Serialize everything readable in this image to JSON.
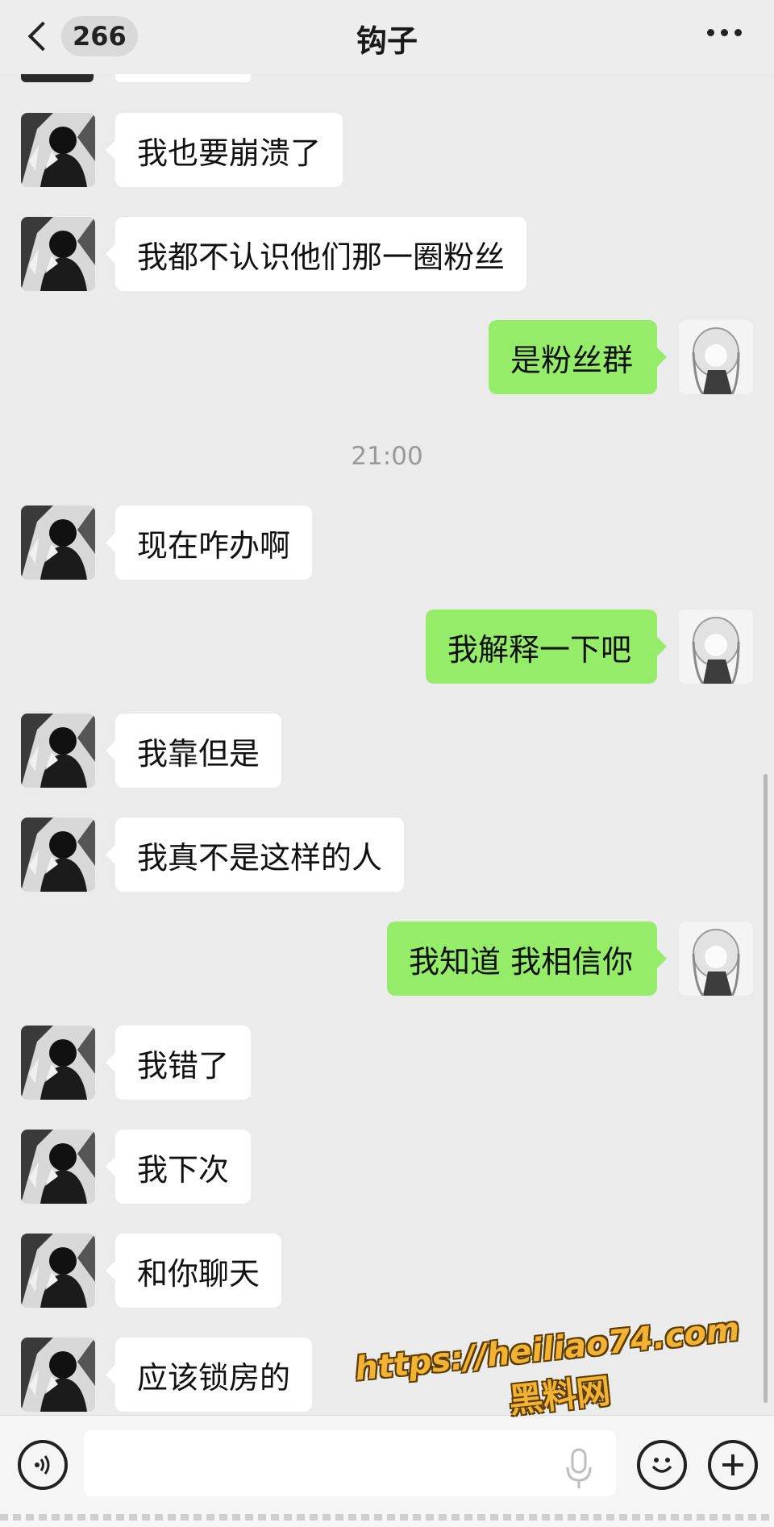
{
  "header": {
    "unread_count": "266",
    "title": "钩子"
  },
  "time_separator": "21:00",
  "messages": [
    {
      "side": "in",
      "text": "我也要崩溃了"
    },
    {
      "side": "in",
      "text": "我都不认识他们那一圈粉丝"
    },
    {
      "side": "out",
      "text": "是粉丝群"
    },
    {
      "side": "in",
      "text": "现在咋办啊"
    },
    {
      "side": "out",
      "text": "我解释一下吧"
    },
    {
      "side": "in",
      "text": "我靠但是"
    },
    {
      "side": "in",
      "text": "我真不是这样的人"
    },
    {
      "side": "out",
      "text": "我知道 我相信你"
    },
    {
      "side": "in",
      "text": "我错了"
    },
    {
      "side": "in",
      "text": "我下次"
    },
    {
      "side": "in",
      "text": "和你聊天"
    },
    {
      "side": "in",
      "text": "应该锁房的"
    }
  ],
  "input_bar": {
    "voice_icon": "voice-wave-icon",
    "mic_icon": "microphone-icon",
    "emoji_icon": "smiley-icon",
    "plus_icon": "plus-icon"
  },
  "watermark": {
    "url": "https://heiliao74.com",
    "name": "黑料网"
  },
  "colors": {
    "background": "#ebebeb",
    "incoming_bubble": "#ffffff",
    "outgoing_bubble": "#95ec69",
    "watermark": "#f2b233"
  }
}
